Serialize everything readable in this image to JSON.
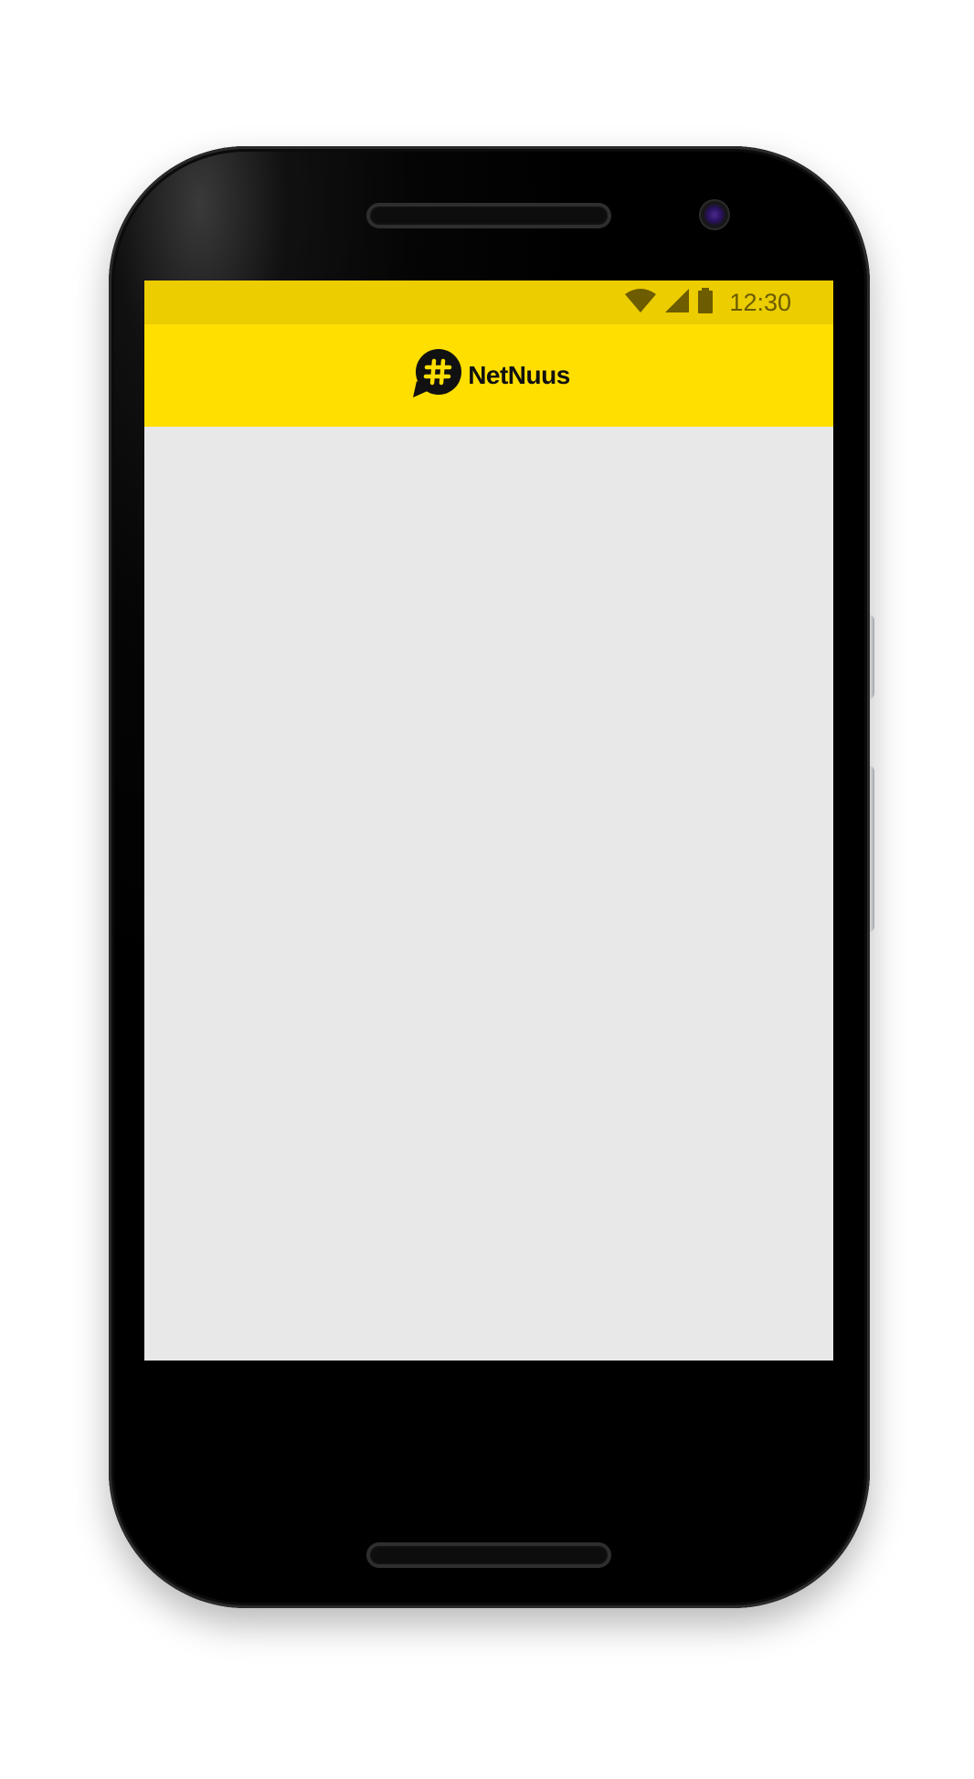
{
  "status_bar": {
    "time": "12:30",
    "icons": [
      "wifi-icon",
      "cell-signal-icon",
      "battery-icon"
    ],
    "background": "#ebcd00",
    "icon_color": "#6d5c00"
  },
  "app_bar": {
    "logo_text": "NetNuus",
    "logo_icon": "hash-speech-bubble-icon",
    "background": "#ffdf00"
  },
  "content": {
    "background": "#e8e8e8"
  }
}
